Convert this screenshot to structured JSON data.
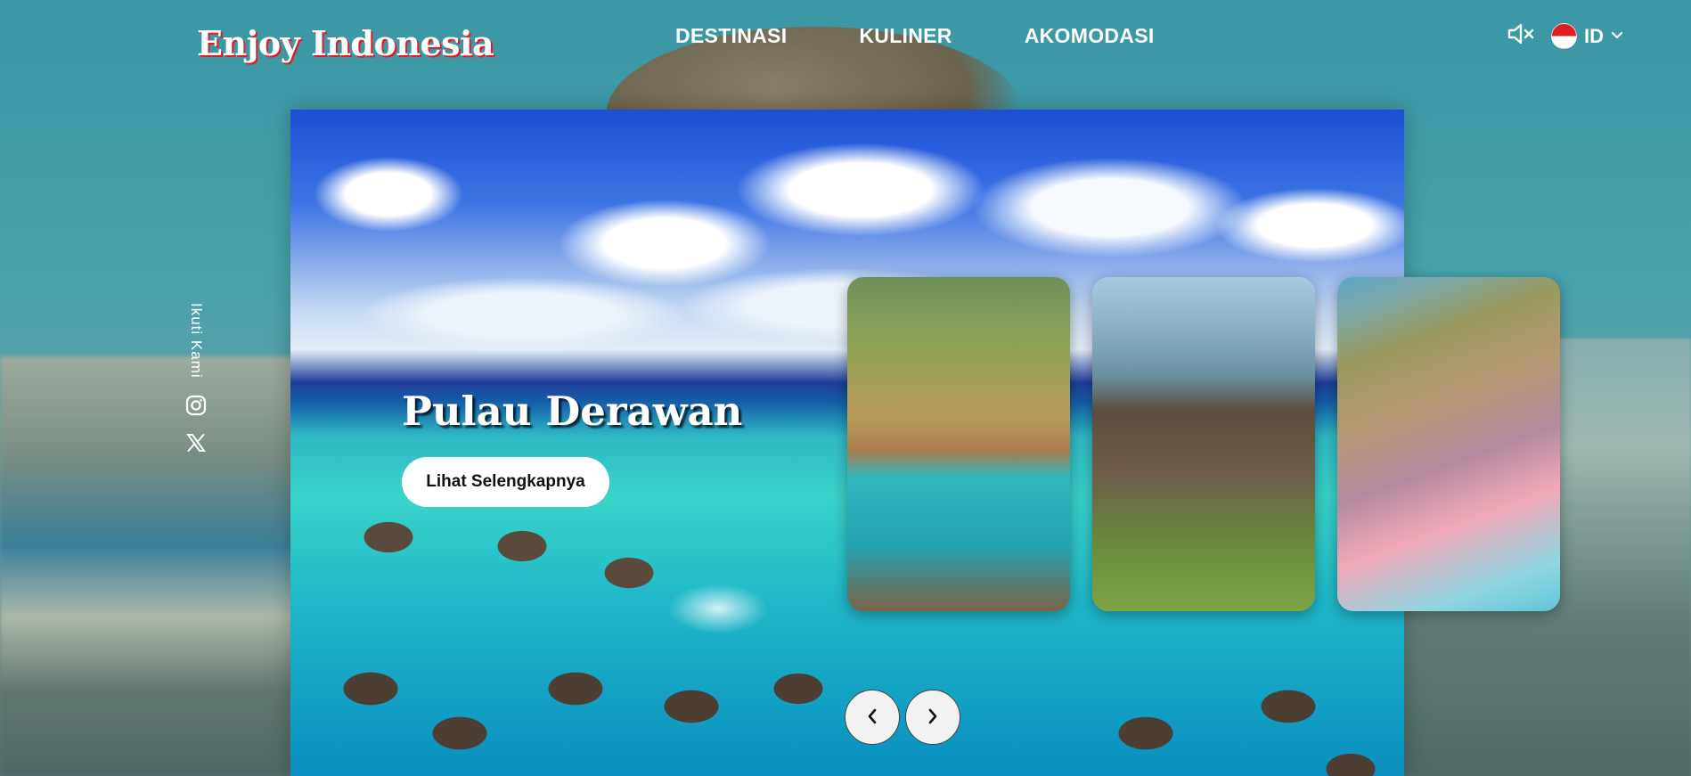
{
  "header": {
    "logo": "Enjoy Indonesia",
    "nav": [
      "DESTINASI",
      "KULINER",
      "AKOMODASI"
    ],
    "language": "ID",
    "mute_icon": "speaker-muted-icon",
    "chevron_icon": "chevron-down-icon"
  },
  "social": {
    "follow_label": "Ikuti Kami",
    "icons": [
      "instagram-icon",
      "x-icon"
    ]
  },
  "slide": {
    "title": "Pulau Derawan",
    "button_label": "Lihat Selengkapnya"
  },
  "controls": {
    "prev_icon": "chevron-left-icon",
    "next_icon": "chevron-right-icon"
  },
  "colors": {
    "logo_accent": "#e31b23",
    "flag_red": "#e31b23",
    "flag_white": "#ffffff"
  }
}
